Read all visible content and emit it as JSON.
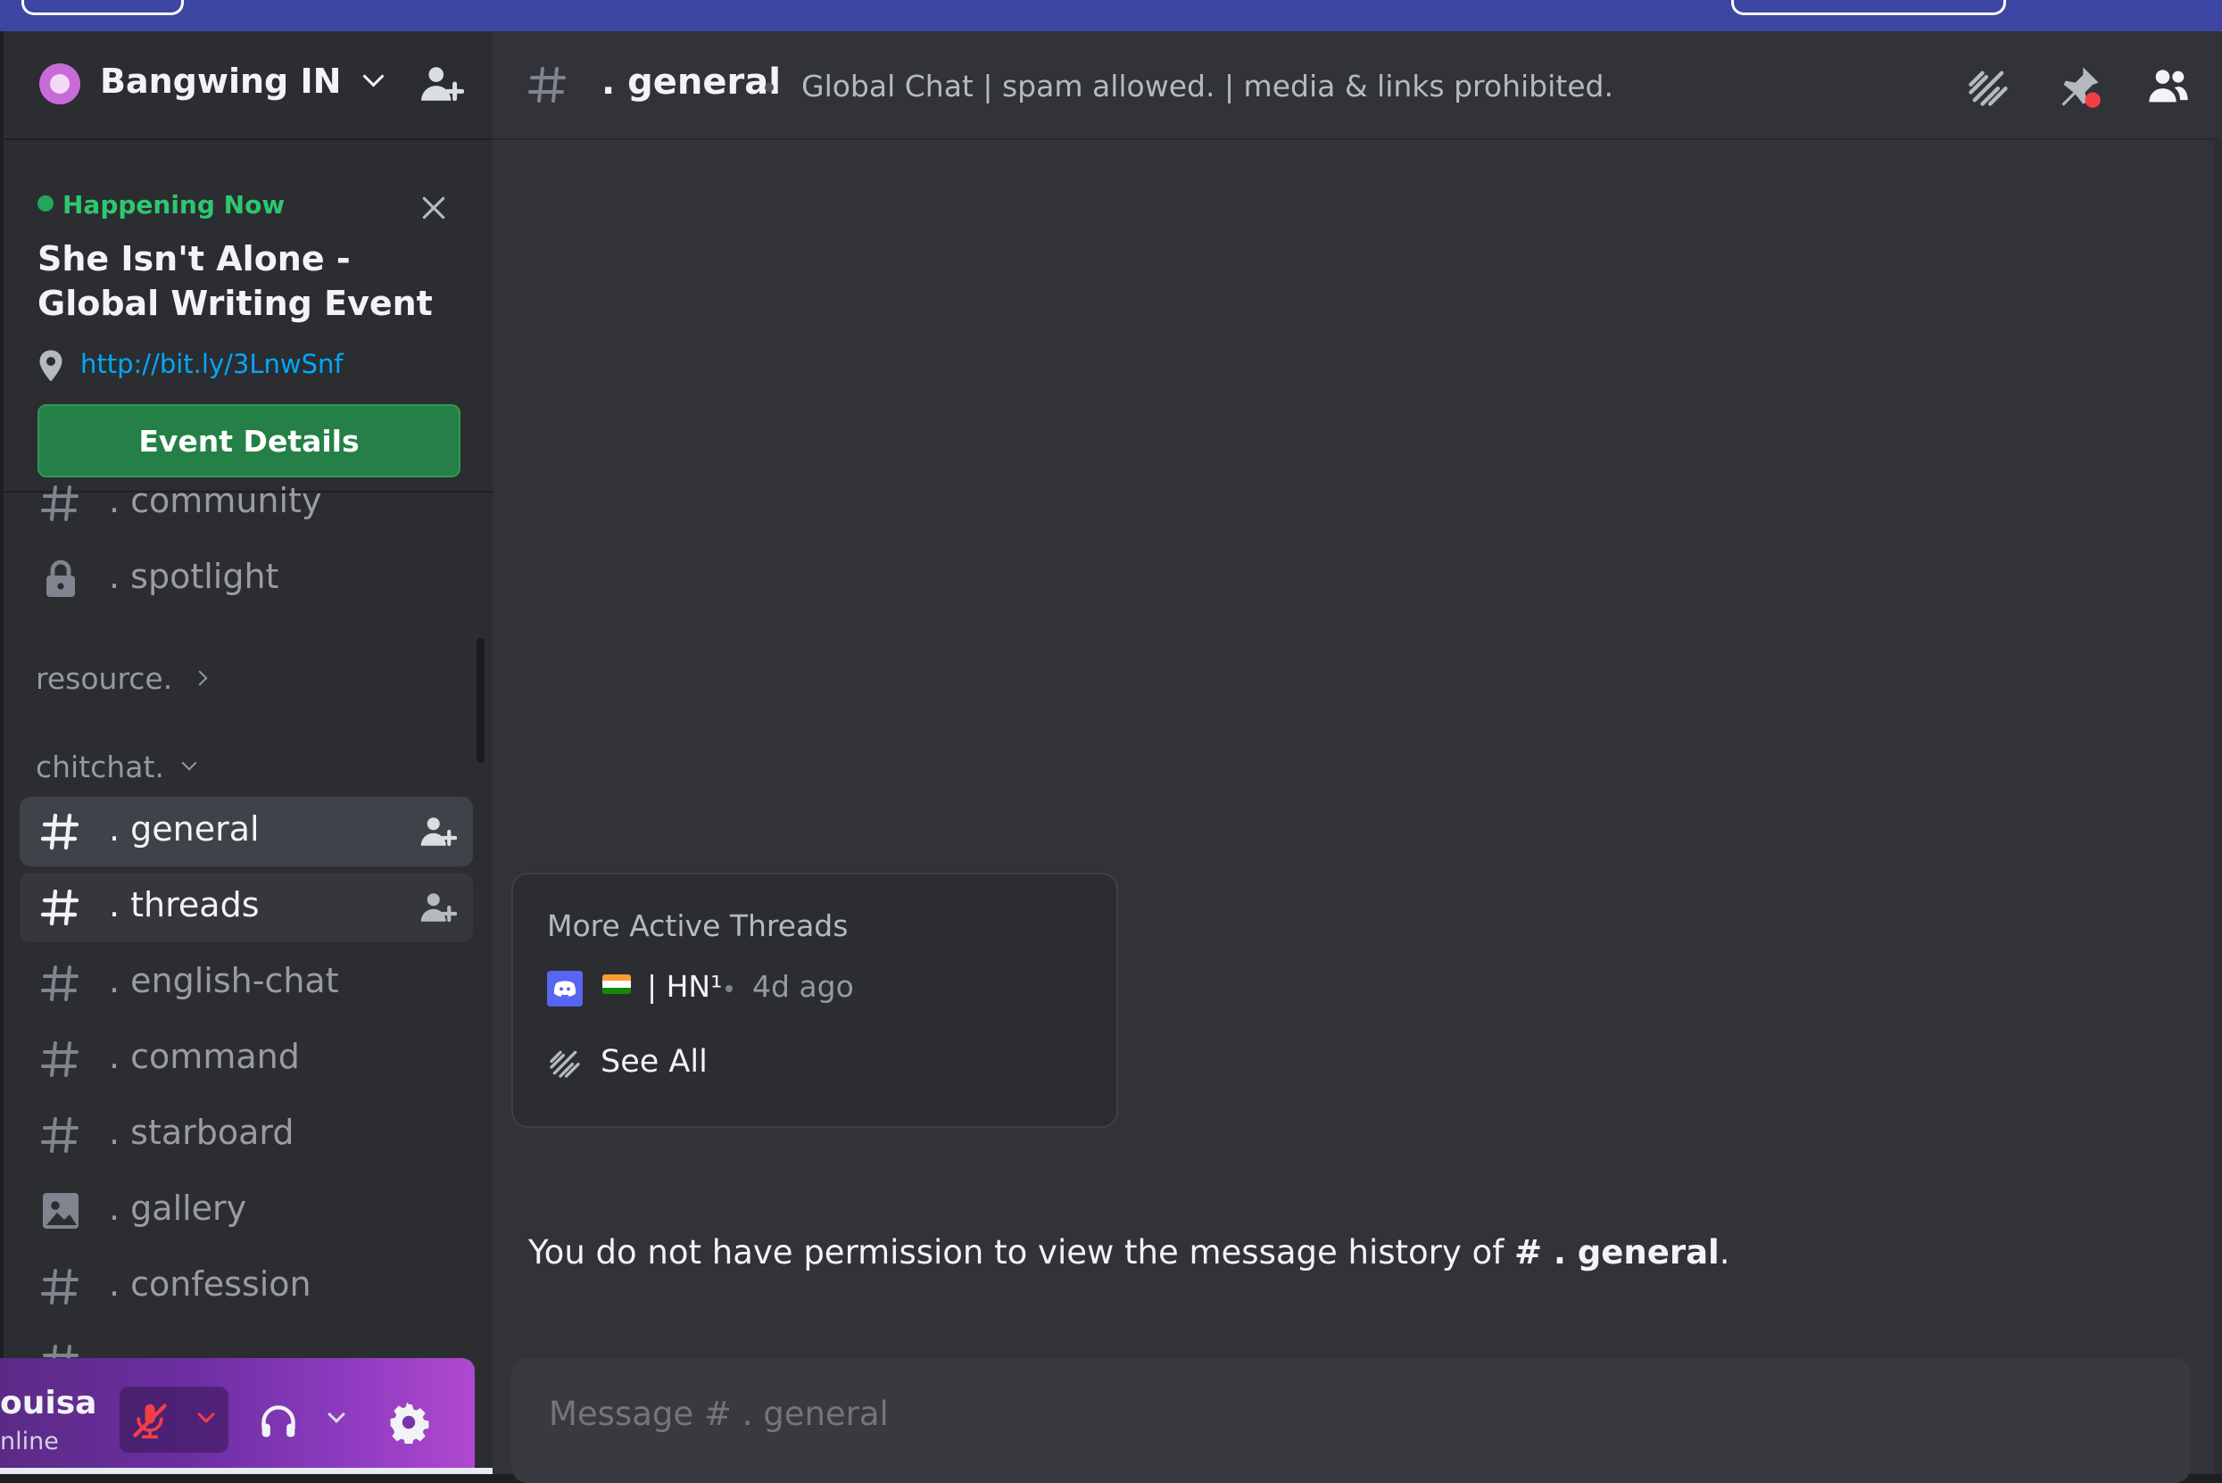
{
  "server": {
    "name": "Bangwing IN"
  },
  "event": {
    "status": "Happening Now",
    "title": "She Isn't Alone - Global Writing Event",
    "link": "http://bit.ly/3LnwSnf",
    "button_label": "Event Details"
  },
  "channels_top": [
    {
      "name": ". community",
      "icon": "hash-icon"
    },
    {
      "name": ". spotlight",
      "icon": "lock-icon"
    }
  ],
  "categories": {
    "resource": "resource.",
    "chitchat": "chitchat."
  },
  "channels": [
    {
      "name": ". general",
      "icon": "hash-icon",
      "state": "active"
    },
    {
      "name": ". threads",
      "icon": "hash-icon",
      "state": "hover"
    },
    {
      "name": ". english-chat",
      "icon": "hash-icon"
    },
    {
      "name": ". command",
      "icon": "hash-icon"
    },
    {
      "name": ". starboard",
      "icon": "hash-icon"
    },
    {
      "name": ". gallery",
      "icon": "image-icon"
    },
    {
      "name": ". confession",
      "icon": "hash-icon"
    }
  ],
  "user": {
    "name": "ouisa",
    "status": "nline"
  },
  "header": {
    "channel_name": ". general",
    "topic": "Global Chat | spam allowed. | media & links prohibited."
  },
  "active_threads": {
    "title": "More Active Threads",
    "thread_name": "| HN¹",
    "time": "4d ago",
    "see_all": "See All"
  },
  "permission": {
    "text": "You do not have permission to view the message history of",
    "channel": "# . general",
    "end": "."
  },
  "composer": {
    "placeholder": "Message # . general"
  },
  "colors": {
    "accent": "#5865f2",
    "event_green": "#248046",
    "online": "#23a55a",
    "link": "#00a8fc",
    "mute_red": "#f23f43"
  }
}
